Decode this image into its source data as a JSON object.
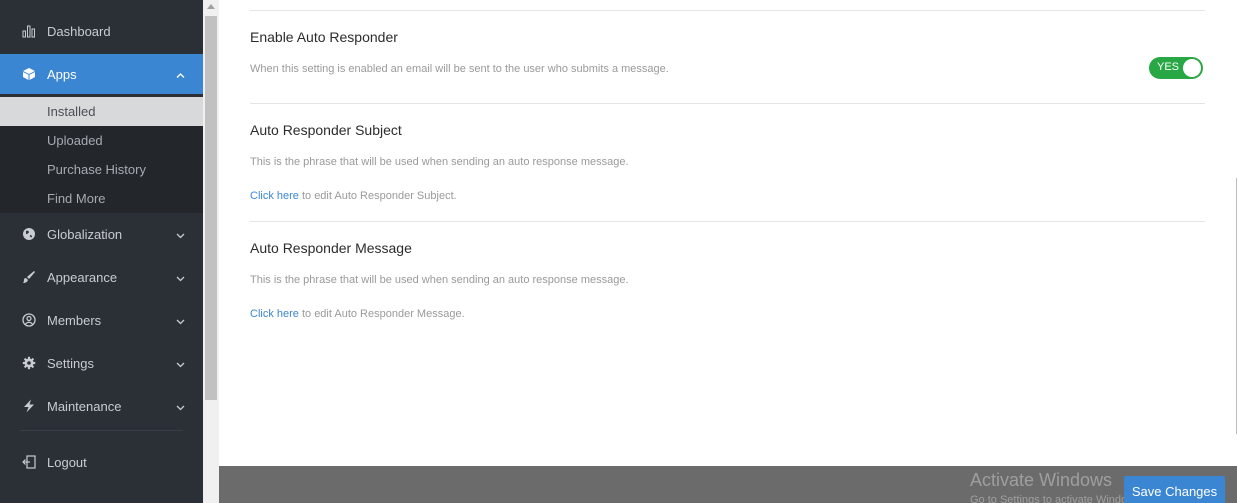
{
  "sidebar": {
    "items": [
      {
        "label": "Dashboard",
        "icon": "bar-chart-icon"
      },
      {
        "label": "Apps",
        "icon": "cube-icon"
      },
      {
        "label": "Globalization",
        "icon": "globe-icon"
      },
      {
        "label": "Appearance",
        "icon": "paintbrush-icon"
      },
      {
        "label": "Members",
        "icon": "user-circle-icon"
      },
      {
        "label": "Settings",
        "icon": "gear-icon"
      },
      {
        "label": "Maintenance",
        "icon": "lightning-icon"
      },
      {
        "label": "Logout",
        "icon": "logout-icon"
      }
    ],
    "apps_subitems": [
      "Installed",
      "Uploaded",
      "Purchase History",
      "Find More"
    ]
  },
  "main": {
    "auto_responder": {
      "title": "Enable Auto Responder",
      "description": "When this setting is enabled an email will be sent to the user who submits a message.",
      "toggle_label": "YES"
    },
    "subject": {
      "title": "Auto Responder Subject",
      "description": "This is the phrase that will be used when sending an auto response message.",
      "link_text": "Click here",
      "edit_text": " to edit Auto Responder Subject."
    },
    "message": {
      "title": "Auto Responder Message",
      "description": "This is the phrase that will be used when sending an auto response message.",
      "link_text": "Click here",
      "edit_text": " to edit Auto Responder Message."
    }
  },
  "footer": {
    "save_label": "Save Changes",
    "watermark_title": "Activate Windows",
    "watermark_sub": "Go to Settings to activate Windows."
  },
  "colors": {
    "accent": "#3b86d3",
    "sidebar_bg": "#2b2f36",
    "toggle_on": "#28a745"
  }
}
